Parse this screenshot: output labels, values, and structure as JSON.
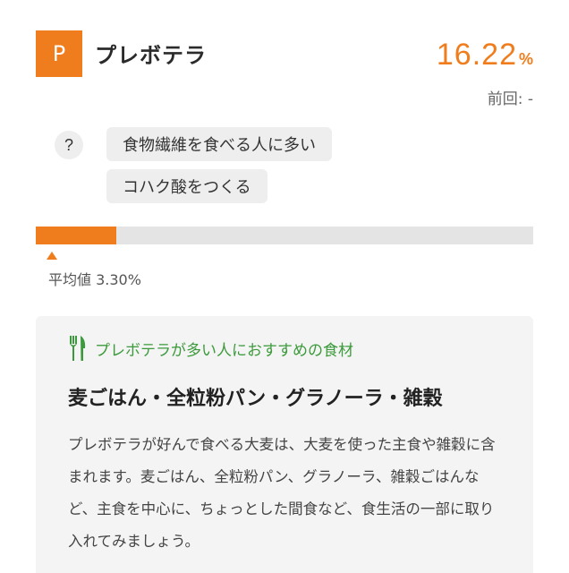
{
  "bacterium": {
    "badge_letter": "P",
    "name": "プレボテラ",
    "percentage": "16.22",
    "percent_unit": "%",
    "previous_label": "前回: -",
    "bar_fill_fraction": 0.1622,
    "accent_color": "#f07d1d"
  },
  "traits": {
    "help_glyph": "?",
    "tags": [
      "食物繊維を食べる人に多い",
      "コハク酸をつくる"
    ]
  },
  "average": {
    "label": "平均値 3.30%",
    "value_fraction": 0.033
  },
  "recommendation": {
    "icon": "fork-knife-icon",
    "icon_color": "#3c9a3c",
    "heading": "プレボテラが多い人におすすめの食材",
    "title": "麦ごはん・全粒粉パン・グラノーラ・雑穀",
    "body": "プレボテラが好んで食べる大麦は、大麦を使った主食や雑穀に含まれます。麦ごはん、全粒粉パン、グラノーラ、雑穀ごはんなど、主食を中心に、ちょっとした間食など、食生活の一部に取り入れてみましょう。"
  }
}
